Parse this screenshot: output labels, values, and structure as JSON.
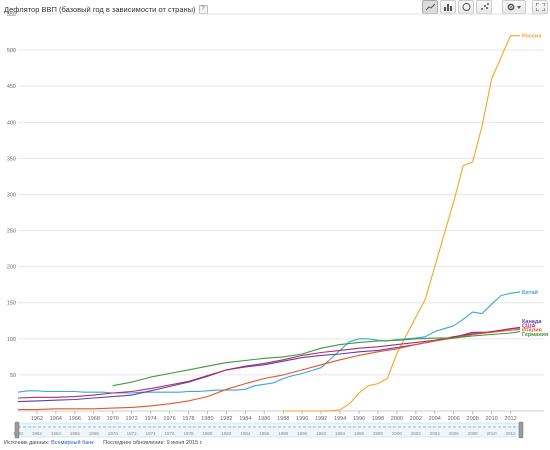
{
  "header": {
    "title": "Дефлятор ВВП (базовый год в зависимости от страны)",
    "help": "?"
  },
  "toolbar": {
    "buttons": [
      "line-chart-icon",
      "bar-chart-icon",
      "scatter-icon",
      "settings-icon"
    ],
    "selected": "line-chart-icon"
  },
  "footer": {
    "source_label": "Источник данных:",
    "source_link": "Всемирный банк",
    "updated": "Последнее обновление: 9 июня 2015 г."
  },
  "colors": {
    "Россия": "#f5a623",
    "Китай": "#3aa8d8",
    "Канада": "#5d3fb0",
    "США": "#b22a66",
    "Италия": "#e8522e",
    "Германия": "#3b9b3b",
    "grid": "#e6e6e6",
    "axis_text": "#666666"
  },
  "chart_data": {
    "type": "line",
    "title": "Дефлятор ВВП (базовый год в зависимости от страны)",
    "xlabel": "",
    "ylabel": "",
    "xlim": [
      1960,
      2013
    ],
    "ylim": [
      0,
      550
    ],
    "yticks": [
      50,
      100,
      150,
      200,
      250,
      300,
      350,
      400,
      450,
      500,
      550
    ],
    "xticks": [
      1962,
      1964,
      1966,
      1968,
      1970,
      1972,
      1974,
      1976,
      1978,
      1980,
      1982,
      1984,
      1986,
      1988,
      1990,
      1992,
      1994,
      1996,
      1998,
      2000,
      2002,
      2004,
      2006,
      2008,
      2010,
      2012
    ],
    "grid": true,
    "legend": "inline-right",
    "series": [
      {
        "name": "Россия",
        "x": [
          1988,
          1989,
          1990,
          1991,
          1992,
          1993,
          1994,
          1995,
          1996,
          1997,
          1998,
          1999,
          2000,
          2001,
          2002,
          2003,
          2004,
          2005,
          2006,
          2007,
          2008,
          2009,
          2010,
          2011,
          2012,
          2013
        ],
        "y": [
          0.001,
          0.001,
          0.002,
          0.002,
          0.04,
          0.4,
          1.6,
          10,
          25,
          35,
          38,
          45,
          80,
          105,
          130,
          155,
          200,
          245,
          290,
          340,
          345,
          395,
          460,
          490,
          520,
          520
        ]
      },
      {
        "name": "Китай",
        "x": [
          1960,
          1961,
          1962,
          1963,
          1964,
          1965,
          1966,
          1967,
          1968,
          1969,
          1970,
          1971,
          1972,
          1973,
          1974,
          1975,
          1976,
          1977,
          1978,
          1979,
          1980,
          1981,
          1982,
          1983,
          1984,
          1985,
          1986,
          1987,
          1988,
          1989,
          1990,
          1991,
          1992,
          1993,
          1994,
          1995,
          1996,
          1997,
          1998,
          1999,
          2000,
          2001,
          2002,
          2003,
          2004,
          2005,
          2006,
          2007,
          2008,
          2009,
          2010,
          2011,
          2012,
          2013
        ],
        "y": [
          26,
          28,
          28,
          27,
          27,
          27,
          27,
          26,
          26,
          26,
          25,
          25,
          25,
          26,
          26,
          26,
          26,
          26,
          27,
          27,
          28,
          29,
          29,
          29,
          30,
          35,
          37,
          39,
          45,
          49,
          52,
          56,
          60,
          72,
          84,
          96,
          100,
          100,
          98,
          97,
          99,
          100,
          101,
          103,
          110,
          114,
          118,
          127,
          137,
          135,
          148,
          160,
          163,
          165
        ]
      },
      {
        "name": "Канада",
        "x": [
          1960,
          1962,
          1964,
          1966,
          1968,
          1970,
          1972,
          1974,
          1976,
          1978,
          1980,
          1982,
          1984,
          1986,
          1988,
          1990,
          1992,
          1994,
          1996,
          1998,
          2000,
          2002,
          2004,
          2006,
          2008,
          2010,
          2012,
          2013
        ],
        "y": [
          13,
          14,
          15,
          16,
          18,
          20,
          22,
          28,
          34,
          40,
          48,
          57,
          61,
          64,
          69,
          74,
          77,
          79,
          82,
          84,
          88,
          92,
          97,
          102,
          109,
          109,
          114,
          115
        ]
      },
      {
        "name": "США",
        "x": [
          1960,
          1962,
          1964,
          1966,
          1968,
          1970,
          1972,
          1974,
          1976,
          1978,
          1980,
          1982,
          1984,
          1986,
          1988,
          1990,
          1992,
          1994,
          1996,
          1998,
          2000,
          2002,
          2004,
          2006,
          2008,
          2010,
          2012,
          2013
        ],
        "y": [
          18,
          19,
          19,
          20,
          22,
          25,
          27,
          31,
          36,
          41,
          49,
          57,
          62,
          66,
          71,
          77,
          81,
          84,
          87,
          89,
          92,
          95,
          98,
          103,
          107,
          110,
          114,
          116
        ]
      },
      {
        "name": "Италия",
        "x": [
          1960,
          1962,
          1964,
          1966,
          1968,
          1970,
          1972,
          1974,
          1976,
          1978,
          1980,
          1982,
          1984,
          1986,
          1988,
          1990,
          1992,
          1994,
          1996,
          1998,
          2000,
          2002,
          2004,
          2006,
          2008,
          2010,
          2012,
          2013
        ],
        "y": [
          2,
          2,
          3,
          3,
          3,
          4,
          5,
          7,
          10,
          14,
          20,
          30,
          38,
          45,
          50,
          57,
          64,
          71,
          77,
          82,
          86,
          92,
          97,
          101,
          106,
          109,
          112,
          113
        ]
      },
      {
        "name": "Германия",
        "x": [
          1970,
          1972,
          1974,
          1976,
          1978,
          1980,
          1982,
          1984,
          1986,
          1988,
          1990,
          1992,
          1994,
          1996,
          1998,
          2000,
          2002,
          2004,
          2006,
          2008,
          2010,
          2012,
          2013
        ],
        "y": [
          35,
          40,
          47,
          52,
          57,
          62,
          67,
          70,
          73,
          75,
          79,
          87,
          92,
          95,
          97,
          98,
          100,
          101,
          101,
          104,
          106,
          108,
          110
        ]
      }
    ]
  },
  "timeline": {
    "labels": [
      1960,
      1962,
      1964,
      1966,
      1968,
      1970,
      1972,
      1974,
      1976,
      1978,
      1980,
      1982,
      1984,
      1986,
      1988,
      1990,
      1992,
      1994,
      1996,
      1998,
      2000,
      2002,
      2004,
      2006,
      2008,
      2010,
      2012
    ]
  }
}
